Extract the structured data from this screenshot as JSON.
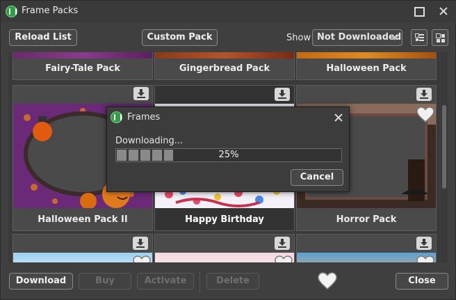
{
  "window": {
    "title": "Frame Packs",
    "app_icon": "app-logo-icon"
  },
  "toolbar": {
    "reload_label": "Reload List",
    "custom_pack_label": "Custom Pack",
    "show_label": "Show",
    "filter_value": "Not Downloaded"
  },
  "packs": [
    {
      "label": "Fairy-Tale Pack"
    },
    {
      "label": "Gingerbread Pack"
    },
    {
      "label": "Halloween Pack"
    },
    {
      "label": "Halloween Pack II"
    },
    {
      "label": "Happy Birthday"
    },
    {
      "label": "Horror Pack"
    }
  ],
  "footer": {
    "download_label": "Download",
    "buy_label": "Buy",
    "activate_label": "Activate",
    "delete_label": "Delete",
    "close_label": "Close"
  },
  "dialog": {
    "title": "Frames",
    "status": "Downloading...",
    "progress_text": "25%",
    "progress_value": 0.25,
    "cancel_label": "Cancel"
  },
  "colors": {
    "accent_green": "#2f9e44",
    "panel": "#3f3f3f"
  }
}
